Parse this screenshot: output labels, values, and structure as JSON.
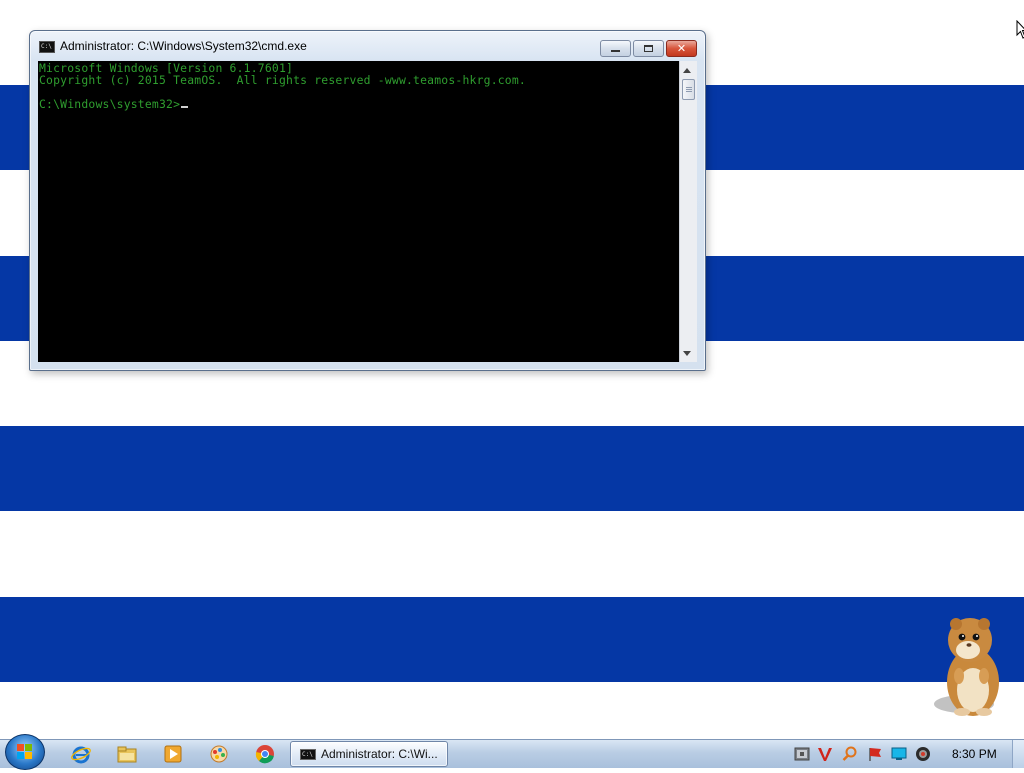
{
  "colors": {
    "wallpaper_blue": "#0537a5",
    "console_bg": "#000000",
    "console_text": "#2f9e2f",
    "close_red": "#c2381f"
  },
  "window": {
    "title": "Administrator: C:\\Windows\\System32\\cmd.exe",
    "icon": "console-icon",
    "console_lines": [
      "Microsoft Windows [Version 6.1.7601]",
      "Copyright (c) 2015 TeamOS.  All rights reserved -www.teamos-hkrg.com.",
      "",
      "C:\\Windows\\system32>"
    ]
  },
  "taskbar": {
    "start_icon": "windows-start-orb-icon",
    "pinned": [
      "internet-explorer-icon",
      "file-explorer-icon",
      "media-player-icon",
      "paint-app-icon",
      "chrome-icon"
    ],
    "active_task_label": "Administrator: C:\\Wi...",
    "tray_icons": [
      "network-tool-icon",
      "antivirus-v-icon",
      "search-magnifier-icon",
      "flag-icon",
      "display-icon",
      "volume-icon"
    ],
    "clock": "8:30 PM"
  },
  "desktop": {
    "mascot": "hamster-mascot-icon",
    "pointer": "mouse-pointer-icon"
  }
}
